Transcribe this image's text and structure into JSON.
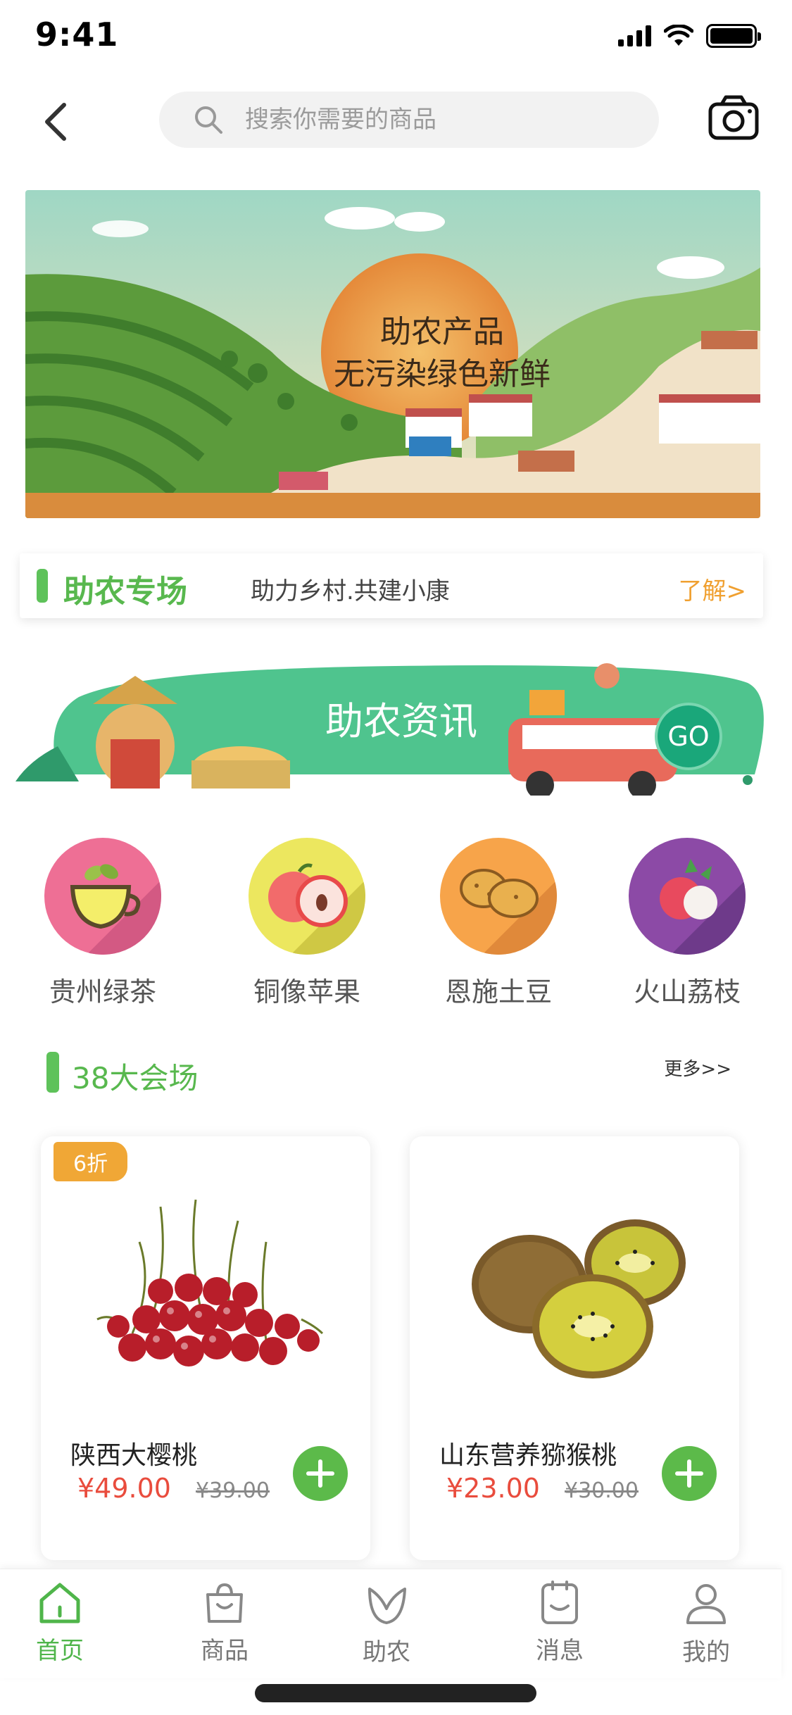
{
  "status": {
    "time": "9:41"
  },
  "header": {
    "search_placeholder": "搜索你需要的商品"
  },
  "hero": {
    "line1": "助农产品",
    "line2": "无污染绿色新鲜"
  },
  "promo": {
    "title": "助农专场",
    "subtitle": "助力乡村.共建小康",
    "link": "了解>"
  },
  "news": {
    "title": "助农资讯",
    "go": "GO"
  },
  "categories": [
    {
      "label": "贵州绿茶",
      "icon": "tea-cup-icon",
      "color": "#ee6f95"
    },
    {
      "label": "铜像苹果",
      "icon": "apple-icon",
      "color": "#ece75f"
    },
    {
      "label": "恩施土豆",
      "icon": "potato-icon",
      "color": "#f7a44a"
    },
    {
      "label": "火山荔枝",
      "icon": "lychee-icon",
      "color": "#8c4aa6"
    }
  ],
  "section": {
    "title": "38大会场",
    "more": "更多>>"
  },
  "products": [
    {
      "badge": "6折",
      "name": "陕西大樱桃",
      "price": "¥49.00",
      "old_price": "¥39.00",
      "image": "cherries"
    },
    {
      "badge": "",
      "name": "山东营养猕猴桃",
      "price": "¥23.00",
      "old_price": "¥30.00",
      "image": "kiwi"
    }
  ],
  "tabs": [
    {
      "label": "首页",
      "icon": "home-icon",
      "active": true
    },
    {
      "label": "商品",
      "icon": "bag-icon",
      "active": false
    },
    {
      "label": "助农",
      "icon": "leaf-icon",
      "active": false
    },
    {
      "label": "消息",
      "icon": "message-icon",
      "active": false
    },
    {
      "label": "我的",
      "icon": "user-icon",
      "active": false
    }
  ],
  "colors": {
    "accent": "#5ec25a",
    "price": "#e94c3d",
    "link": "#f0a030"
  }
}
